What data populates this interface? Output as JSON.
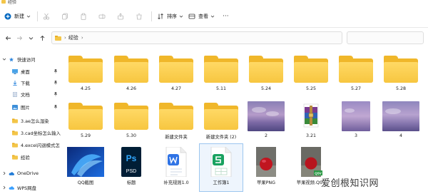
{
  "window": {
    "title": "经验"
  },
  "toolbar": {
    "new_label": "新建",
    "sort_label": "排序",
    "view_label": "查看",
    "more_label": "···"
  },
  "address": {
    "crumbs": [
      "经验"
    ],
    "search_placeholder": ""
  },
  "sidebar": {
    "quick_access": "快速访问",
    "items": [
      {
        "label": "桌面",
        "icon": "desktop-icon",
        "pinned": true
      },
      {
        "label": "下载",
        "icon": "download-icon",
        "pinned": true
      },
      {
        "label": "文档",
        "icon": "document-icon",
        "pinned": true
      },
      {
        "label": "图片",
        "icon": "picture-icon",
        "pinned": true
      },
      {
        "label": "3.ae怎么湿染",
        "icon": "folder-icon",
        "pinned": false
      },
      {
        "label": "3.cad坐标怎么输入",
        "icon": "folder-icon",
        "pinned": false
      },
      {
        "label": "4.excel闪退模式怎",
        "icon": "folder-icon",
        "pinned": false
      },
      {
        "label": "经验",
        "icon": "folder-icon",
        "pinned": false
      }
    ],
    "onedrive": "OneDrive",
    "wps": "WPS网盘"
  },
  "files": {
    "row1": [
      "4.25",
      "4.26",
      "4.27",
      "5.11",
      "5.24",
      "5.25",
      "5.27",
      "5.28"
    ],
    "row2": [
      "5.29",
      "5.30",
      "新建文件夹",
      "新建文件夹 (2)",
      "2",
      "3.21",
      "3",
      "4"
    ],
    "row3": [
      "QQ截图",
      "标题",
      "补充规则1.0",
      "工作簿1",
      "苹果PNG",
      "苹果视频.QSV"
    ]
  },
  "file_types": {
    "psd_badge": "PSD",
    "ps_mark": "Ps",
    "video_badge": "QSV"
  },
  "watermark": "爱创根知识网",
  "colors": {
    "folder": "#f7c640",
    "accent": "#0067c0",
    "ps_blue": "#31a8ff",
    "wps_blue": "#2f73e5",
    "excel_green": "#1aa260"
  }
}
